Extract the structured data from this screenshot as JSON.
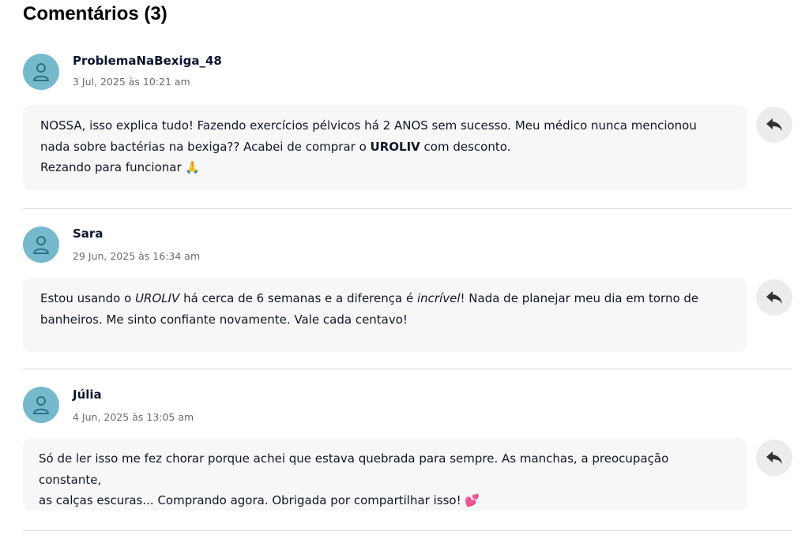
{
  "page": {
    "title": "Comentários (3)"
  },
  "colors": {
    "avatar_bg": "#76b9cd",
    "bubble_bg": "#f7f7f7",
    "reply_bg": "#ececec"
  },
  "comments": [
    {
      "author": "ProblemaNaBexiga_48",
      "date": "3 Jul, 2025 às 10:21 am",
      "line1": "NOSSA, isso explica tudo! Fazendo exercícios pélvicos há 2 ANOS sem sucesso. Meu médico nunca mencionou",
      "line2_a": "nada sobre bactérias na bexiga?? Acabei de comprar o ",
      "line2_brand": "UROLIV",
      "line2_b": " com desconto.",
      "line3": "Rezando para funcionar 🙏",
      "icons": [
        "user-icon",
        "reply-icon"
      ]
    },
    {
      "author": "Sara",
      "date": "29 Jun, 2025 às 16:34 am",
      "line1_a": "Estou usando o ",
      "line1_brand": "UROLIV",
      "line1_b": " há cerca de 6 semanas e a diferença é ",
      "line1_em": "incrível",
      "line1_c": "! Nada de planejar meu dia em torno de",
      "line2": "banheiros. Me sinto confiante novamente. Vale cada centavo!",
      "icons": [
        "user-icon",
        "reply-icon"
      ]
    },
    {
      "author": "Júlia",
      "date": "4 Jun, 2025 às 13:05 am",
      "line1": "Só de ler isso me fez chorar porque achei que estava quebrada para sempre. As manchas, a preocupação constante,",
      "line2": "as calças escuras... Comprando agora. Obrigada por compartilhar isso! 💕",
      "icons": [
        "user-icon",
        "reply-icon"
      ]
    }
  ]
}
